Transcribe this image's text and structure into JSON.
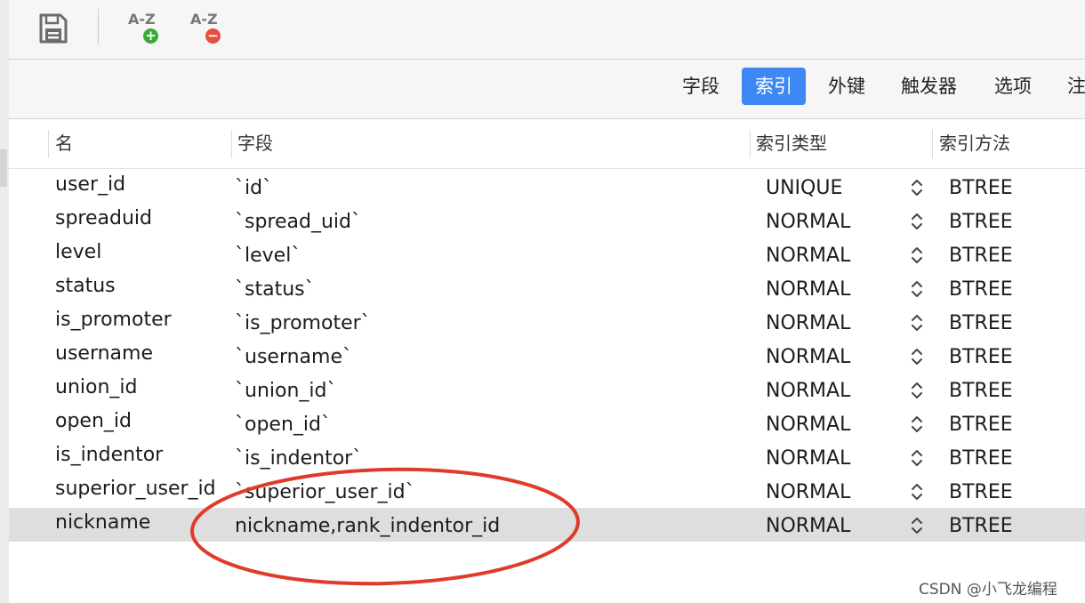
{
  "toolbar": {
    "save_icon": "floppy-disk-icon",
    "sort_az_add": {
      "label": "A-Z",
      "badge": "+",
      "badge_color": "#3aaa35"
    },
    "sort_az_remove": {
      "label": "A-Z",
      "badge": "−",
      "badge_color": "#e84d3d"
    }
  },
  "tabs": [
    {
      "label": "字段",
      "active": false
    },
    {
      "label": "索引",
      "active": true
    },
    {
      "label": "外键",
      "active": false
    },
    {
      "label": "触发器",
      "active": false
    },
    {
      "label": "选项",
      "active": false
    },
    {
      "label": "注",
      "active": false
    }
  ],
  "colors": {
    "accent": "#3d88f4",
    "annotation": "#e03a2a",
    "selected_row": "#dedede"
  },
  "table": {
    "columns": [
      "名",
      "字段",
      "索引类型",
      "索引方法"
    ],
    "rows": [
      {
        "name": "user_id",
        "field": "`id`",
        "type": "UNIQUE",
        "method": "BTREE",
        "selected": false
      },
      {
        "name": "spreaduid",
        "field": "`spread_uid`",
        "type": "NORMAL",
        "method": "BTREE",
        "selected": false
      },
      {
        "name": "level",
        "field": "`level`",
        "type": "NORMAL",
        "method": "BTREE",
        "selected": false
      },
      {
        "name": "status",
        "field": "`status`",
        "type": "NORMAL",
        "method": "BTREE",
        "selected": false
      },
      {
        "name": "is_promoter",
        "field": "`is_promoter`",
        "type": "NORMAL",
        "method": "BTREE",
        "selected": false
      },
      {
        "name": "username",
        "field": "`username`",
        "type": "NORMAL",
        "method": "BTREE",
        "selected": false
      },
      {
        "name": "union_id",
        "field": "`union_id`",
        "type": "NORMAL",
        "method": "BTREE",
        "selected": false
      },
      {
        "name": "open_id",
        "field": "`open_id`",
        "type": "NORMAL",
        "method": "BTREE",
        "selected": false
      },
      {
        "name": "is_indentor",
        "field": "`is_indentor`",
        "type": "NORMAL",
        "method": "BTREE",
        "selected": false
      },
      {
        "name": "superior_user_id",
        "field": "`superior_user_id`",
        "type": "NORMAL",
        "method": "BTREE",
        "selected": false
      },
      {
        "name": "nickname",
        "field": "nickname,rank_indentor_id",
        "type": "NORMAL",
        "method": "BTREE",
        "selected": true
      }
    ]
  },
  "watermark": "CSDN @小飞龙编程"
}
